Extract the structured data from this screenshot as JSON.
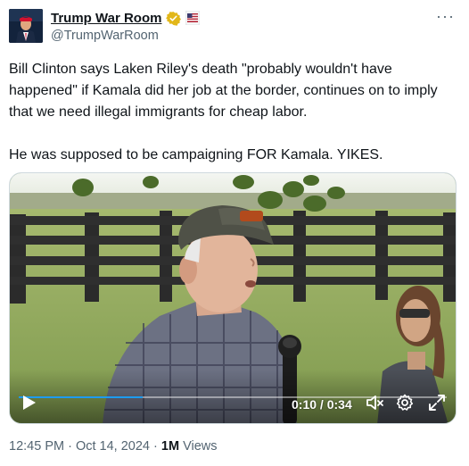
{
  "account": {
    "display_name": "Trump War Room",
    "handle": "@TrumpWarRoom",
    "verified_color": "#e2b719"
  },
  "tweet": {
    "paragraph1": "Bill Clinton says Laken Riley's death \"probably wouldn't have happened\" if Kamala did her job at the border, continues on to imply that we need illegal immigrants for cheap labor.",
    "paragraph2": "He was supposed to be campaigning FOR Kamala. YIKES."
  },
  "video": {
    "current_time": "0:10",
    "separator": " / ",
    "duration": "0:34",
    "progress": 0.29,
    "icons": [
      "play-icon",
      "muted-volume-icon",
      "settings-gear-icon",
      "fullscreen-icon"
    ]
  },
  "meta": {
    "time": "12:45 PM",
    "date": "Oct 14, 2024",
    "dot": " · ",
    "views_count": "1M",
    "views_label": "Views"
  },
  "colors": {
    "accent": "#1d9bf0",
    "secondary_text": "#536471"
  }
}
